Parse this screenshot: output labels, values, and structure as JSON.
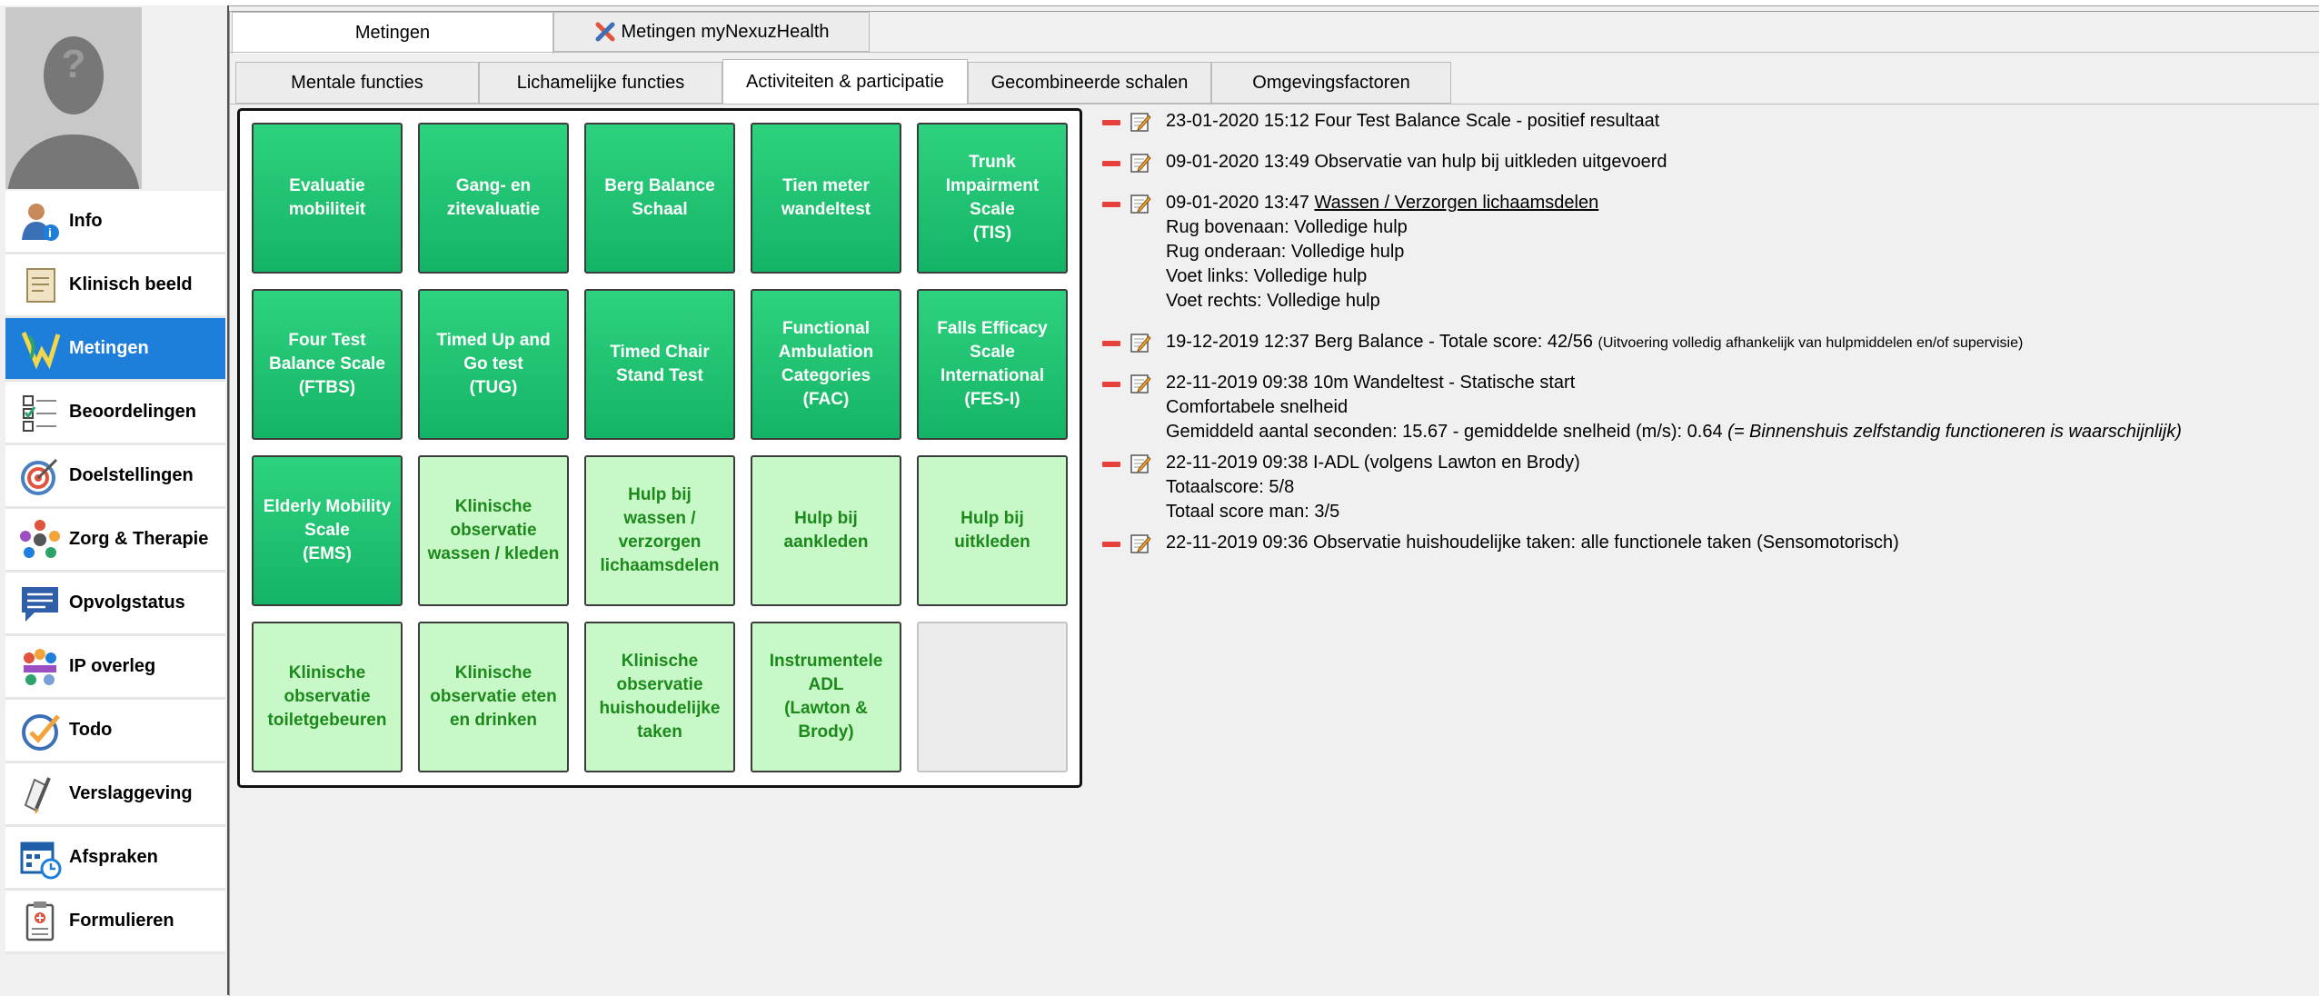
{
  "sidebar": {
    "avatar_glyph": "?",
    "items": [
      {
        "label": "Info",
        "icon": "user-info-icon"
      },
      {
        "label": "Klinisch beeld",
        "icon": "clinical-document-icon"
      },
      {
        "label": "Metingen",
        "icon": "measurements-icon"
      },
      {
        "label": "Beoordelingen",
        "icon": "checklist-icon"
      },
      {
        "label": "Doelstellingen",
        "icon": "target-icon"
      },
      {
        "label": "Zorg & Therapie",
        "icon": "care-team-icon"
      },
      {
        "label": "Opvolgstatus",
        "icon": "chat-bubble-icon"
      },
      {
        "label": "IP overleg",
        "icon": "team-meeting-icon"
      },
      {
        "label": "Todo",
        "icon": "checkmark-icon"
      },
      {
        "label": "Verslaggeving",
        "icon": "pen-report-icon"
      },
      {
        "label": "Afspraken",
        "icon": "calendar-clock-icon"
      },
      {
        "label": "Formulieren",
        "icon": "form-clipboard-icon"
      }
    ],
    "active_item": "Metingen"
  },
  "tabs": {
    "top": [
      {
        "label": "Metingen",
        "active": true
      },
      {
        "label": "Metingen myNexuzHealth",
        "icon": "nexuz-x-icon",
        "active": false
      }
    ],
    "sub": [
      {
        "label": "Mentale functies",
        "active": false
      },
      {
        "label": "Lichamelijke functies",
        "active": false
      },
      {
        "label": "Activiteiten & participatie",
        "active": true
      },
      {
        "label": "Gecombineerde schalen",
        "active": false
      },
      {
        "label": "Omgevingsfactoren",
        "active": false
      }
    ]
  },
  "tiles": [
    {
      "label": "Evaluatie\nmobiliteit",
      "style": "dark"
    },
    {
      "label": "Gang- en\nzitevaluatie",
      "style": "dark"
    },
    {
      "label": "Berg Balance\nSchaal",
      "style": "dark"
    },
    {
      "label": "Tien meter\nwandeltest",
      "style": "dark"
    },
    {
      "label": "Trunk\nImpairment\nScale\n(TIS)",
      "style": "dark"
    },
    {
      "label": "Four Test\nBalance Scale\n(FTBS)",
      "style": "dark"
    },
    {
      "label": "Timed Up and\nGo test\n(TUG)",
      "style": "dark"
    },
    {
      "label": "Timed Chair\nStand Test",
      "style": "dark"
    },
    {
      "label": "Functional\nAmbulation\nCategories\n(FAC)",
      "style": "dark"
    },
    {
      "label": "Falls Efficacy\nScale\nInternational\n(FES-I)",
      "style": "dark"
    },
    {
      "label": "Elderly Mobility\nScale\n(EMS)",
      "style": "dark"
    },
    {
      "label": "Klinische\nobservatie\nwassen / kleden",
      "style": "light"
    },
    {
      "label": "Hulp bij\nwassen /\nverzorgen\nlichaamsdelen",
      "style": "light"
    },
    {
      "label": "Hulp bij\naankleden",
      "style": "light"
    },
    {
      "label": "Hulp bij\nuitkleden",
      "style": "light"
    },
    {
      "label": "Klinische\nobservatie\ntoiletgebeuren",
      "style": "light"
    },
    {
      "label": "Klinische\nobservatie eten\nen drinken",
      "style": "light"
    },
    {
      "label": "Klinische\nobservatie\nhuishoudelijke\ntaken",
      "style": "light"
    },
    {
      "label": "Instrumentele\nADL\n(Lawton &\nBrody)",
      "style": "light"
    },
    {
      "label": "",
      "style": "empty"
    }
  ],
  "log": [
    {
      "head": "23-01-2020 15:12 Four Test Balance Scale - positief resultaat",
      "lines": []
    },
    {
      "head": "09-01-2020 13:49 Observatie van hulp bij uitkleden uitgevoerd",
      "lines": []
    },
    {
      "head": "09-01-2020 13:47 ",
      "link": "Wassen / Verzorgen lichaamsdelen",
      "lines": [
        "Rug bovenaan: Volledige hulp",
        "Rug onderaan: Volledige hulp",
        "Voet links: Volledige hulp",
        "Voet rechts: Volledige hulp"
      ]
    },
    {
      "head": "19-12-2019 12:37 Berg Balance - Totale score: 42/56 ",
      "small": "(Uitvoering volledig afhankelijk van hulpmiddelen en/of supervisie)",
      "lines": []
    },
    {
      "head": "22-11-2019 09:38 10m Wandeltest - Statische start",
      "lines": [
        "Comfortabele snelheid",
        "Gemiddeld aantal seconden: 15.67 - gemiddelde snelheid (m/s): 0.64 "
      ],
      "italic": "(= Binnenshuis zelfstandig functioneren is waarschijnlijk)"
    },
    {
      "head": "22-11-2019 09:38 I-ADL (volgens Lawton en Brody)",
      "lines": [
        "Totaalscore: 5/8",
        "Totaal score man: 3/5"
      ]
    },
    {
      "head": "22-11-2019 09:36 Observatie huishoudelijke taken: alle functionele taken (Sensomotorisch)",
      "lines": []
    }
  ]
}
